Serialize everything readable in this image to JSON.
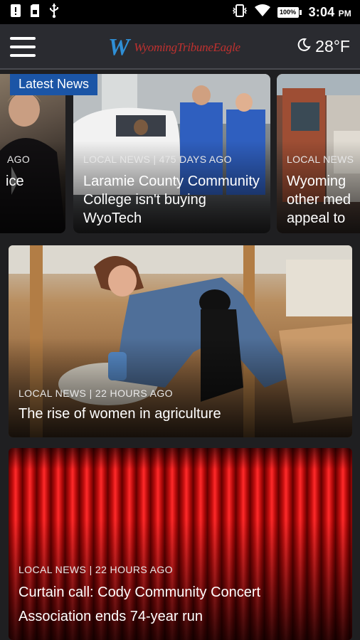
{
  "status_bar": {
    "time": "3:04",
    "ampm": "PM",
    "battery": "100%"
  },
  "app_bar": {
    "brand_initial": "W",
    "brand_name": "WyomingTribuneEagle",
    "temperature": "28°F"
  },
  "latest_badge": "Latest News",
  "carousel": [
    {
      "meta": "AGO",
      "title": "ice"
    },
    {
      "meta": "LOCAL NEWS | 475 DAYS AGO",
      "title": "Laramie County Community College isn't buying WyoTech"
    },
    {
      "meta": "LOCAL NEWS",
      "title": "Wyoming other med appeal to"
    }
  ],
  "feed": [
    {
      "meta": "LOCAL NEWS | 22 HOURS AGO",
      "title": "The rise of women in agriculture"
    },
    {
      "meta": "LOCAL NEWS | 22 HOURS AGO",
      "title_line1": "Curtain call: Cody Community Concert",
      "title_line2": "Association ends 74-year run"
    }
  ],
  "colors": {
    "badge": "#1b55a6",
    "brand_w": "#2f8fd6",
    "brand_name": "#c0312f",
    "app_bar": "#2a2b30"
  }
}
